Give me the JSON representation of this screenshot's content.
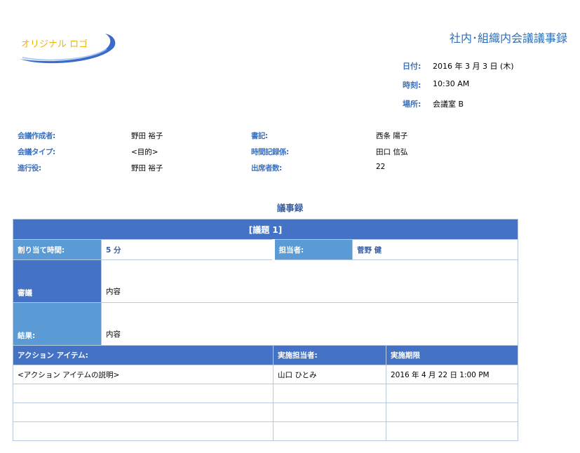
{
  "logo": {
    "text": "オリジナル ロゴ",
    "colors": {
      "text": "#f0b400",
      "swoosh": "#2e63c8"
    }
  },
  "header": {
    "title": "社内･組織内会議議事録"
  },
  "meeting_meta": [
    {
      "label": "日付:",
      "value": "2016 年 3 月 3 日 (木)"
    },
    {
      "label": "時刻:",
      "value": "10:30 AM"
    },
    {
      "label": "場所:",
      "value": "会議室 B"
    }
  ],
  "info": {
    "rows": [
      {
        "label1": "会議作成者:",
        "value1": "野田 裕子",
        "label2": "書記:",
        "value2": "西条 陽子"
      },
      {
        "label1": "会議タイプ:",
        "value1": "<目的>",
        "label2": "時間記録係:",
        "value2": "田口 信弘"
      },
      {
        "label1": "進行役:",
        "value1": "野田 裕子",
        "label2": "出席者数:",
        "value2": "22"
      }
    ]
  },
  "minutes": {
    "heading": "議事録",
    "topic": "[議題 1]",
    "allotted_label": "割り当て時間:",
    "allotted_value": "5 分",
    "owner_label": "担当者:",
    "owner_value": "菅野 健",
    "discussion_label": "審議",
    "discussion_value": "内容",
    "result_label": "結果:",
    "result_value": "内容",
    "action_headers": [
      "アクション アイテム:",
      "実施担当者:",
      "実施期限"
    ],
    "action_rows": [
      [
        "<アクション アイテムの説明>",
        "山口 ひとみ",
        "2016 年 4 月 22 日 1:00 PM"
      ],
      [
        "",
        "",
        ""
      ],
      [
        "",
        "",
        ""
      ],
      [
        "",
        "",
        ""
      ]
    ]
  },
  "colors": {
    "accent": "#4472c4",
    "accent_light": "#5b9bd5",
    "label_text": "#3a72c0",
    "title": "#2e6fb5"
  }
}
